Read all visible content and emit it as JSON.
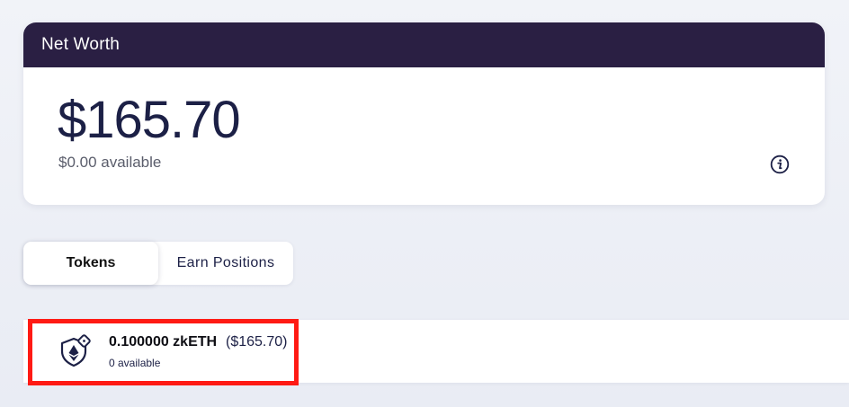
{
  "networth": {
    "title": "Net Worth",
    "value": "$165.70",
    "available": "$0.00 available",
    "info_icon": "info-icon"
  },
  "tabs": [
    {
      "label": "Tokens",
      "active": true
    },
    {
      "label": "Earn Positions",
      "active": false
    }
  ],
  "tokens": [
    {
      "icon": "shielded-eth-icon",
      "amount": "0.100000 zkETH",
      "value": "($165.70)",
      "available": "0 available"
    }
  ],
  "colors": {
    "header_bg": "#2a1f43",
    "text_primary": "#1c2046",
    "highlight_border": "#ff1a14",
    "page_bg": "#eef0f6"
  }
}
